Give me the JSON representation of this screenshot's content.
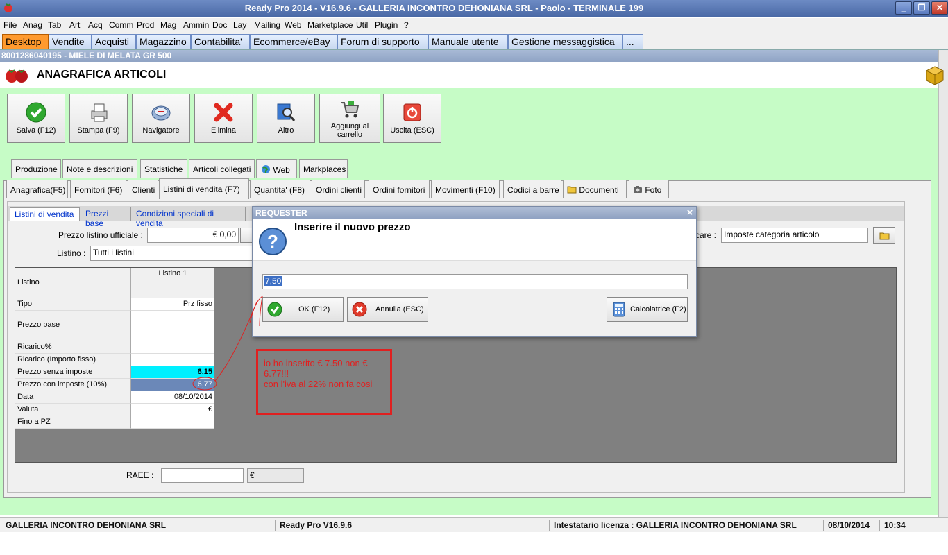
{
  "window": {
    "title": "Ready Pro 2014 - V16.9.6 - GALLERIA INCONTRO DEHONIANA SRL - Paolo - TERMINALE 199",
    "min": "_",
    "restore": "❐",
    "close": "✕"
  },
  "menu": [
    "File",
    "Anag",
    "Tab",
    "Art",
    "Acq",
    "Comm",
    "Prod",
    "Mag",
    "Ammin",
    "Doc",
    "Lay",
    "Mailing",
    "Web",
    "Marketplace",
    "Util",
    "Plugin",
    "?"
  ],
  "app_tabs": [
    "Desktop",
    "Vendite",
    "Acquisti",
    "Magazzino",
    "Contabilita'",
    "Ecommerce/eBay",
    "Forum di supporto",
    "Manuale utente",
    "Gestione messaggistica",
    "..."
  ],
  "document_bar": "8001286040195 - MIELE DI MELATA GR 500",
  "page_title": "ANAGRAFICA ARTICOLI",
  "toolbar": [
    {
      "label": "Salva (F12)",
      "icon": "check-icon"
    },
    {
      "label": "Stampa (F9)",
      "icon": "printer-icon"
    },
    {
      "label": "Navigatore",
      "icon": "compass-icon"
    },
    {
      "label": "Elimina",
      "icon": "delete-icon"
    },
    {
      "label": "Altro",
      "icon": "search-icon"
    },
    {
      "label": "Aggiungi al carrello",
      "icon": "cart-icon"
    },
    {
      "label": "Uscita (ESC)",
      "icon": "exit-icon"
    }
  ],
  "tabs_row1": [
    "Produzione",
    "Note e descrizioni",
    "Statistiche",
    "Articoli collegati",
    "Web",
    "Markplaces"
  ],
  "tabs_row2": [
    "Anagrafica(F5)",
    "Fornitori (F6)",
    "Clienti",
    "Listini di vendita (F7)",
    "Quantita' (F8)",
    "Ordini clienti",
    "Ordini fornitori",
    "Movimenti (F10)",
    "Codici a barre",
    "Documenti",
    "Foto"
  ],
  "subtabs": [
    "Listini di vendita",
    "Prezzi base",
    "Condizioni speciali di vendita"
  ],
  "form": {
    "prezzo_label": "Prezzo listino ufficiale :",
    "prezzo_value": "€ 0,00",
    "listino_label": "Listino :",
    "listino_value": "Tutti i listini",
    "imposte_label": "care :",
    "imposte_value": "Imposte categoria articolo",
    "raee_label": "RAEE :",
    "raee_currency": "€"
  },
  "grid": {
    "column": "Listino 1",
    "rows": [
      {
        "label": "Listino",
        "value": ""
      },
      {
        "label": "Tipo",
        "value": "Prz fisso"
      },
      {
        "label": "Prezzo base",
        "value": ""
      },
      {
        "label": "Ricarico%",
        "value": ""
      },
      {
        "label": "Ricarico (Importo fisso)",
        "value": ""
      },
      {
        "label": "Prezzo senza imposte",
        "value": "6,15"
      },
      {
        "label": "Prezzo con imposte (10%)",
        "value": "6,77"
      },
      {
        "label": "Data",
        "value": "08/10/2014"
      },
      {
        "label": "Valuta",
        "value": "€"
      },
      {
        "label": "Fino a PZ",
        "value": ""
      }
    ]
  },
  "dialog": {
    "title": "REQUESTER",
    "close": "×",
    "message": "Inserire il nuovo prezzo",
    "input_value": "7,50",
    "ok_label": "OK (F12)",
    "cancel_label": "Annulla (ESC)",
    "calc_label": "Calcolatrice (F2)"
  },
  "annotation": {
    "lines": [
      "io ho inserito € 7.50 non € 6.77!!!",
      "con l'iva al 22% non fa cosi"
    ],
    "color": "#e02020"
  },
  "status": {
    "company": "GALLERIA INCONTRO DEHONIANA SRL",
    "version": "Ready Pro V16.9.6",
    "license": "Intestatario licenza : GALLERIA INCONTRO DEHONIANA SRL",
    "date": "08/10/2014",
    "time": "10:34"
  }
}
